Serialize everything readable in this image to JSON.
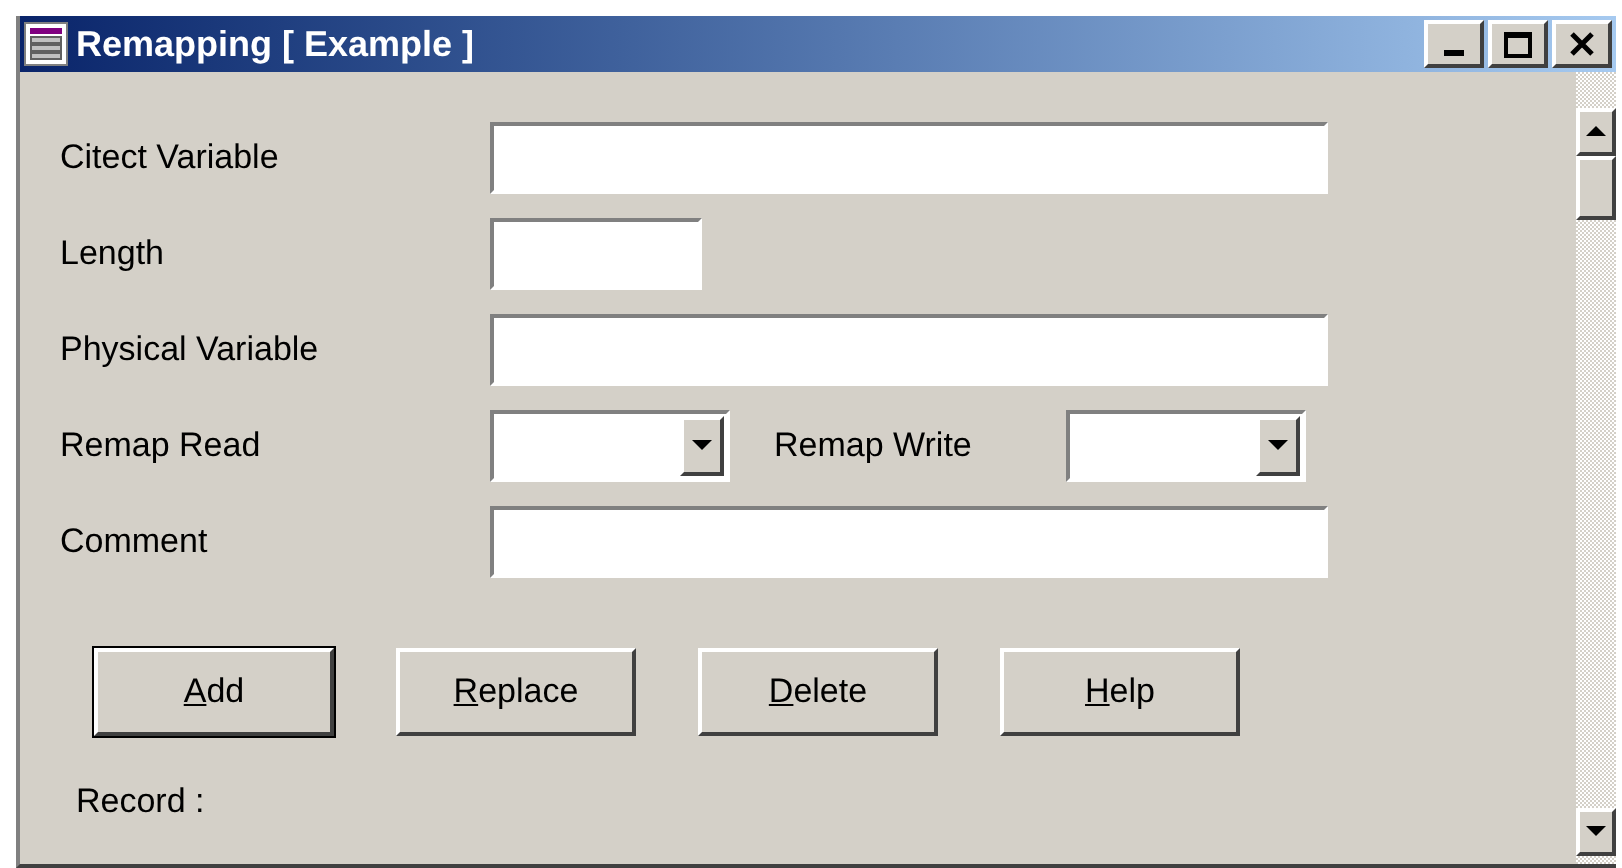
{
  "window": {
    "title": "Remapping [ Example ]"
  },
  "fields": [
    {
      "kind": "wide",
      "label": "Citect Variable"
    },
    {
      "kind": "short",
      "label": "Length"
    },
    {
      "kind": "wide",
      "label": "Physical Variable"
    },
    {
      "kind": "dropdowns",
      "items": [
        {
          "label": "Remap Read"
        },
        {
          "label": "Remap Write"
        }
      ]
    },
    {
      "kind": "wide",
      "label": "Comment"
    }
  ],
  "buttons": [
    {
      "label": "Add",
      "default": true,
      "mnemonic_underlined": true
    },
    {
      "label": "Replace",
      "default": false,
      "mnemonic_underlined": true
    },
    {
      "label": "Delete",
      "default": false,
      "mnemonic_underlined": true
    },
    {
      "label": "Help",
      "default": false,
      "mnemonic_underlined": true
    }
  ],
  "status": {
    "label": "Record :"
  }
}
